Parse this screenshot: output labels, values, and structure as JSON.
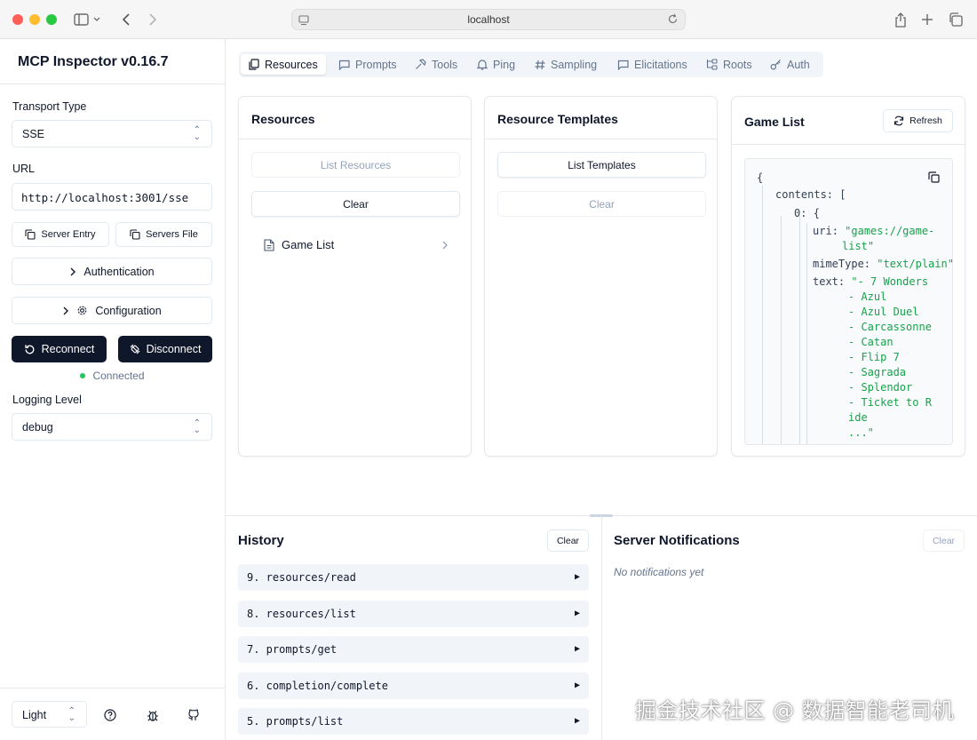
{
  "browser": {
    "url": "localhost"
  },
  "sidebar": {
    "app_title": "MCP Inspector v0.16.7",
    "transport_label": "Transport Type",
    "transport_value": "SSE",
    "url_label": "URL",
    "url_value": "http://localhost:3001/sse",
    "server_entry": "Server Entry",
    "servers_file": "Servers File",
    "authentication": "Authentication",
    "configuration": "Configuration",
    "reconnect": "Reconnect",
    "disconnect": "Disconnect",
    "status": "Connected",
    "logging_label": "Logging Level",
    "logging_value": "debug",
    "theme": "Light"
  },
  "tabs": [
    "Resources",
    "Prompts",
    "Tools",
    "Ping",
    "Sampling",
    "Elicitations",
    "Roots",
    "Auth"
  ],
  "resources_card": {
    "title": "Resources",
    "list_button": "List Resources",
    "clear_button": "Clear",
    "items": [
      "Game List"
    ]
  },
  "templates_card": {
    "title": "Resource Templates",
    "list_button": "List Templates",
    "clear_button": "Clear"
  },
  "detail_card": {
    "title": "Game List",
    "refresh": "Refresh",
    "json": {
      "open_brace": "{",
      "contents_key": "contents",
      "contents_open": "[",
      "index_key": "0",
      "index_open": "{",
      "uri_key": "uri",
      "uri_line1": "\"games://game-",
      "uri_line2": "list\"",
      "mime_key": "mimeType",
      "mime_value": "\"text/plain\"",
      "text_key": "text",
      "text_lines": [
        "\"- 7 Wonders",
        "- Azul",
        "- Azul Duel",
        "- Carcassonne",
        "- Catan",
        "- Flip 7",
        "- Sagrada",
        "- Splendor",
        "- Ticket to R",
        "ide",
        "...\""
      ]
    }
  },
  "history": {
    "title": "History",
    "clear": "Clear",
    "items": [
      "9. resources/read",
      "8. resources/list",
      "7. prompts/get",
      "6. completion/complete",
      "5. prompts/list"
    ]
  },
  "notifications": {
    "title": "Server Notifications",
    "clear": "Clear",
    "empty": "No notifications yet"
  },
  "watermark": "掘金技术社区 @ 数据智能老司机"
}
